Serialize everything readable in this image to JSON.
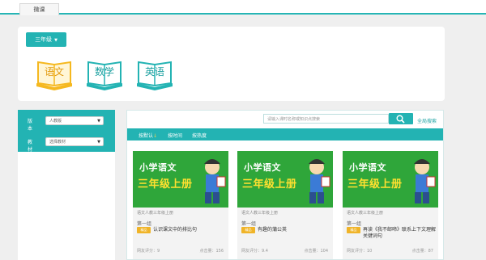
{
  "top_tab": "微课",
  "grade": {
    "label": "三年级"
  },
  "subjects": [
    {
      "label": "语文",
      "selected": true,
      "color": "#f5b81f"
    },
    {
      "label": "数学",
      "selected": false,
      "color": "#23b3b3"
    },
    {
      "label": "英语",
      "selected": false,
      "color": "#23b3b3"
    }
  ],
  "filters": {
    "edition": {
      "label": "版本",
      "value": "人教版"
    },
    "textbook": {
      "label": "教材",
      "value": "选择教材"
    }
  },
  "search": {
    "placeholder": "请输入课时名称或知识点搜索",
    "full_search": "全局搜索"
  },
  "sort": [
    "按默认",
    "按时间",
    "按热度"
  ],
  "cards": [
    {
      "cover_title": "小学语文",
      "cover_grade": "三年级上册",
      "book": "语文人教三年级上册",
      "unit": "第一组",
      "badge": "精品",
      "title": "认识课文中的排比句",
      "rating": "网友评分：9",
      "clicks": "点击量：156"
    },
    {
      "cover_title": "小学语文",
      "cover_grade": "三年级上册",
      "book": "语文人教三年级上册",
      "unit": "第一组",
      "badge": "精品",
      "title": "有趣的蒲公英",
      "rating": "网友评分：9.4",
      "clicks": "点击量：104"
    },
    {
      "cover_title": "小学语文",
      "cover_grade": "三年级上册",
      "book": "语文人教三年级上册",
      "unit": "第一组",
      "badge": "精品",
      "title": "再读《我不邮啼》联系上下文理解关键词句",
      "rating": "网友评分：10",
      "clicks": "点击量：87"
    }
  ],
  "colors": {
    "accent": "#23b3b3",
    "badge": "#f0b428",
    "cover": "#2fa63a",
    "cover_grade": "#ffe030"
  }
}
